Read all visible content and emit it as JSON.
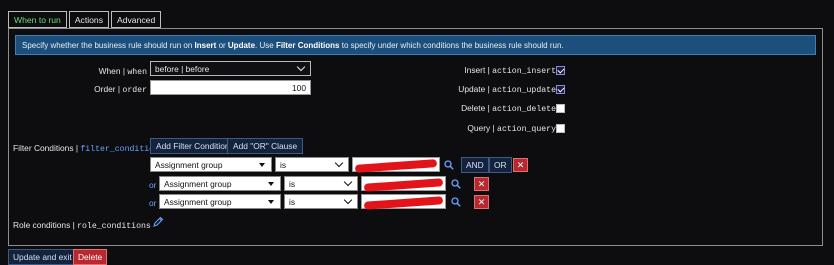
{
  "tabs": [
    {
      "label": "When to run",
      "active": true
    },
    {
      "label": "Actions",
      "active": false
    },
    {
      "label": "Advanced",
      "active": false
    }
  ],
  "info": {
    "part1": "Specify whether the business rule should run on ",
    "insert": "Insert",
    "part2": " or ",
    "update": "Update",
    "part3": ". Use ",
    "filter": "Filter Conditions",
    "part4": " to specify under which conditions the business rule should run."
  },
  "form": {
    "when_label": "When",
    "when_field": "when",
    "when_value": "before | before",
    "order_label": "Order",
    "order_field": "order",
    "order_value": "100",
    "insert_label": "Insert",
    "insert_field": "action_insert",
    "insert_checked": true,
    "update_label": "Update",
    "update_field": "action_update",
    "update_checked": true,
    "delete_label": "Delete",
    "delete_field": "action_delete",
    "delete_checked": false,
    "query_label": "Query",
    "query_field": "action_query",
    "query_checked": false,
    "filter_label": "Filter Conditions",
    "filter_field": "filter_condition",
    "add_filter_label": "Add Filter Condition",
    "add_or_label": "Add \"OR\" Clause",
    "role_label": "Role conditions",
    "role_field": "role_conditions"
  },
  "conditions": [
    {
      "prefix": "",
      "field": "Assignment group",
      "operator": "is"
    },
    {
      "prefix": "or",
      "field": "Assignment group",
      "operator": "is"
    },
    {
      "prefix": "or",
      "field": "Assignment group",
      "operator": "is"
    }
  ],
  "row_buttons": {
    "and": "AND",
    "or": "OR",
    "remove": "✕"
  },
  "footer": {
    "update_exit": "Update and exit",
    "delete": "Delete"
  },
  "colors": {
    "accent": "#6fdc7c",
    "info_bg": "#1c4f7c",
    "danger": "#b8282e",
    "link": "#6aa2ff"
  }
}
